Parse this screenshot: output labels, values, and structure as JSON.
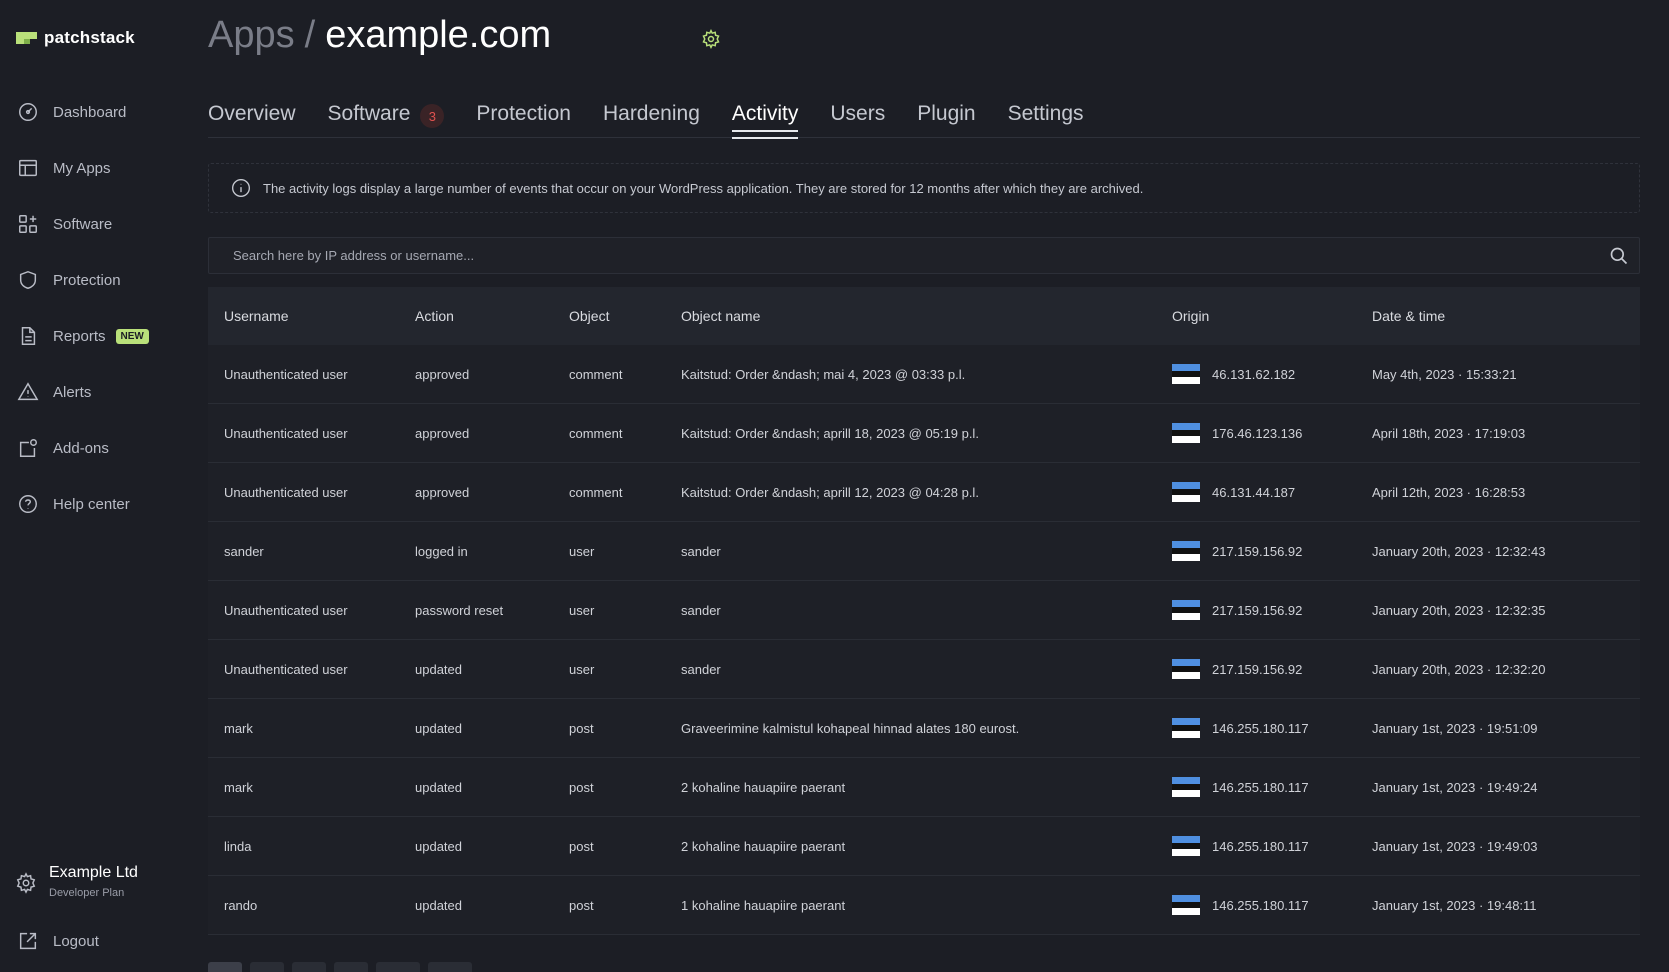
{
  "sidebar": {
    "logo_text": "patchstack",
    "items": [
      {
        "label": "Dashboard",
        "icon": "dashboard-icon"
      },
      {
        "label": "My Apps",
        "icon": "apps-icon"
      },
      {
        "label": "Software",
        "icon": "software-icon"
      },
      {
        "label": "Protection",
        "icon": "shield-icon"
      },
      {
        "label": "Reports",
        "icon": "report-icon",
        "badge": "NEW"
      },
      {
        "label": "Alerts",
        "icon": "alert-icon"
      },
      {
        "label": "Add-ons",
        "icon": "addons-icon"
      },
      {
        "label": "Help center",
        "icon": "help-icon"
      }
    ],
    "org_name": "Example Ltd",
    "org_plan": "Developer Plan",
    "logout_label": "Logout"
  },
  "header": {
    "breadcrumb_root": "Apps",
    "breadcrumb_sep": "/",
    "site": "example.com"
  },
  "tabs": [
    {
      "label": "Overview"
    },
    {
      "label": "Software",
      "count": "3"
    },
    {
      "label": "Protection"
    },
    {
      "label": "Hardening"
    },
    {
      "label": "Activity",
      "active": true
    },
    {
      "label": "Users"
    },
    {
      "label": "Plugin"
    },
    {
      "label": "Settings"
    }
  ],
  "info_text": "The activity logs display a large number of events that occur on your WordPress application. They are stored for 12 months after which they are archived.",
  "search": {
    "placeholder": "Search here by IP address or username..."
  },
  "table": {
    "columns": [
      "Username",
      "Action",
      "Object",
      "Object name",
      "Origin",
      "Date & time"
    ],
    "rows": [
      {
        "username": "Unauthenticated user",
        "action": "approved",
        "object": "comment",
        "object_name": "Kaitstud: Order &ndash; mai 4, 2023 @ 03:33 p.l.",
        "origin": "46.131.62.182",
        "datetime": "May 4th, 2023 · 15:33:21"
      },
      {
        "username": "Unauthenticated user",
        "action": "approved",
        "object": "comment",
        "object_name": "Kaitstud: Order &ndash; aprill 18, 2023 @ 05:19 p.l.",
        "origin": "176.46.123.136",
        "datetime": "April 18th, 2023 · 17:19:03"
      },
      {
        "username": "Unauthenticated user",
        "action": "approved",
        "object": "comment",
        "object_name": "Kaitstud: Order &ndash; aprill 12, 2023 @ 04:28 p.l.",
        "origin": "46.131.44.187",
        "datetime": "April 12th, 2023 · 16:28:53"
      },
      {
        "username": "sander",
        "action": "logged in",
        "object": "user",
        "object_name": "sander",
        "origin": "217.159.156.92",
        "datetime": "January 20th, 2023 · 12:32:43"
      },
      {
        "username": "Unauthenticated user",
        "action": "password reset",
        "object": "user",
        "object_name": "sander",
        "origin": "217.159.156.92",
        "datetime": "January 20th, 2023 · 12:32:35"
      },
      {
        "username": "Unauthenticated user",
        "action": "updated",
        "object": "user",
        "object_name": "sander",
        "origin": "217.159.156.92",
        "datetime": "January 20th, 2023 · 12:32:20"
      },
      {
        "username": "mark",
        "action": "updated",
        "object": "post",
        "object_name": "Graveerimine kalmistul kohapeal hinnad alates 180 eurost.",
        "origin": "146.255.180.117",
        "datetime": "January 1st, 2023 · 19:51:09"
      },
      {
        "username": "mark",
        "action": "updated",
        "object": "post",
        "object_name": "2 kohaline hauapiire paerant",
        "origin": "146.255.180.117",
        "datetime": "January 1st, 2023 · 19:49:24"
      },
      {
        "username": "linda",
        "action": "updated",
        "object": "post",
        "object_name": "2 kohaline hauapiire paerant",
        "origin": "146.255.180.117",
        "datetime": "January 1st, 2023 · 19:49:03"
      },
      {
        "username": "rando",
        "action": "updated",
        "object": "post",
        "object_name": "1 kohaline hauapiire paerant",
        "origin": "146.255.180.117",
        "datetime": "January 1st, 2023 · 19:48:11"
      }
    ]
  },
  "colors": {
    "accent": "#b9e07a",
    "flag_blue": "#4f8fe0",
    "flag_black": "#111111",
    "flag_white": "#ffffff",
    "badge_red": "#e0524f"
  }
}
